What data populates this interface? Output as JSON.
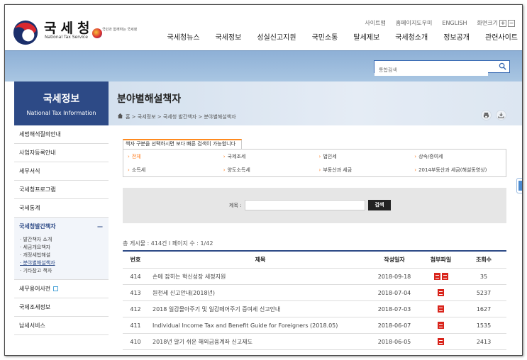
{
  "header": {
    "logo_ko": "국세청",
    "logo_en": "National Tax Service",
    "badge_text": "국민과 함께하는 국세청",
    "util": [
      "사이트맵",
      "홈페이지도우미",
      "ENGLISH",
      "화면크기"
    ],
    "zoom_in": "+",
    "zoom_out": "−",
    "gnb": [
      "국세청뉴스",
      "국세정보",
      "성실신고지원",
      "국민소통",
      "탈세제보",
      "국세청소개",
      "정보공개",
      "관련사이트"
    ]
  },
  "search": {
    "placeholder": "통합검색"
  },
  "lnb": {
    "title": "국세정보",
    "subtitle": "National Tax Information",
    "items": [
      "세법해석질의안내",
      "사업자등록안내",
      "세무서식",
      "국세청프로그램",
      "국세통계"
    ],
    "active": "국세청발간책자",
    "active_toggle": "—",
    "sub": [
      "· 발간책자 소개",
      "· 세금개요책자",
      "· 개정세법해설",
      "· 분야별해설책자",
      "· 기타참고 책자"
    ],
    "after": [
      "세무용어사전",
      "국제조세정보",
      "납세서비스"
    ]
  },
  "page": {
    "title": "분야별해설책자",
    "breadcrumb": "홈 > 국세정보 > 국세청 발간책자 > 분야별해설책자"
  },
  "categories": {
    "tab_label": "책자 구분을 선택하시면 보다 빠른 검색이 가능합니다",
    "row1": [
      "전체",
      "국제조세",
      "법인세",
      "상속/증여세"
    ],
    "row2": [
      "소득세",
      "양도소득세",
      "부동산과 세금",
      "2014부동산과 세금(해설동영상)"
    ]
  },
  "filter": {
    "label": "제목 :",
    "button": "검색"
  },
  "count_text": "총 게시물 : 414건 l 페이지 수 : 1/42",
  "table": {
    "headers": [
      "번호",
      "제목",
      "작성일자",
      "첨부파일",
      "조회수"
    ],
    "rows": [
      {
        "no": "414",
        "title": "손에 잡히는 혁신성장 세정지원",
        "date": "2018-09-18",
        "files": 2,
        "views": "35"
      },
      {
        "no": "413",
        "title": "원천세 신고안내(2018년)",
        "date": "2018-07-04",
        "files": 1,
        "views": "5237"
      },
      {
        "no": "412",
        "title": "2018 일감몰아주기 및 일감떼어주기 증여세 신고안내",
        "date": "2018-07-03",
        "files": 1,
        "views": "1627"
      },
      {
        "no": "411",
        "title": "Individual Income Tax and Benefit Guide for Foreigners (2018.05)",
        "date": "2018-06-07",
        "files": 1,
        "views": "1535"
      },
      {
        "no": "410",
        "title": "2018년 알기 쉬운 해외금융계좌 신고제도",
        "date": "2018-06-05",
        "files": 1,
        "views": "2413"
      }
    ]
  },
  "colors": {
    "navy": "#2d4a86",
    "orange": "#ff7a1a",
    "pdf": "#d9251c"
  }
}
